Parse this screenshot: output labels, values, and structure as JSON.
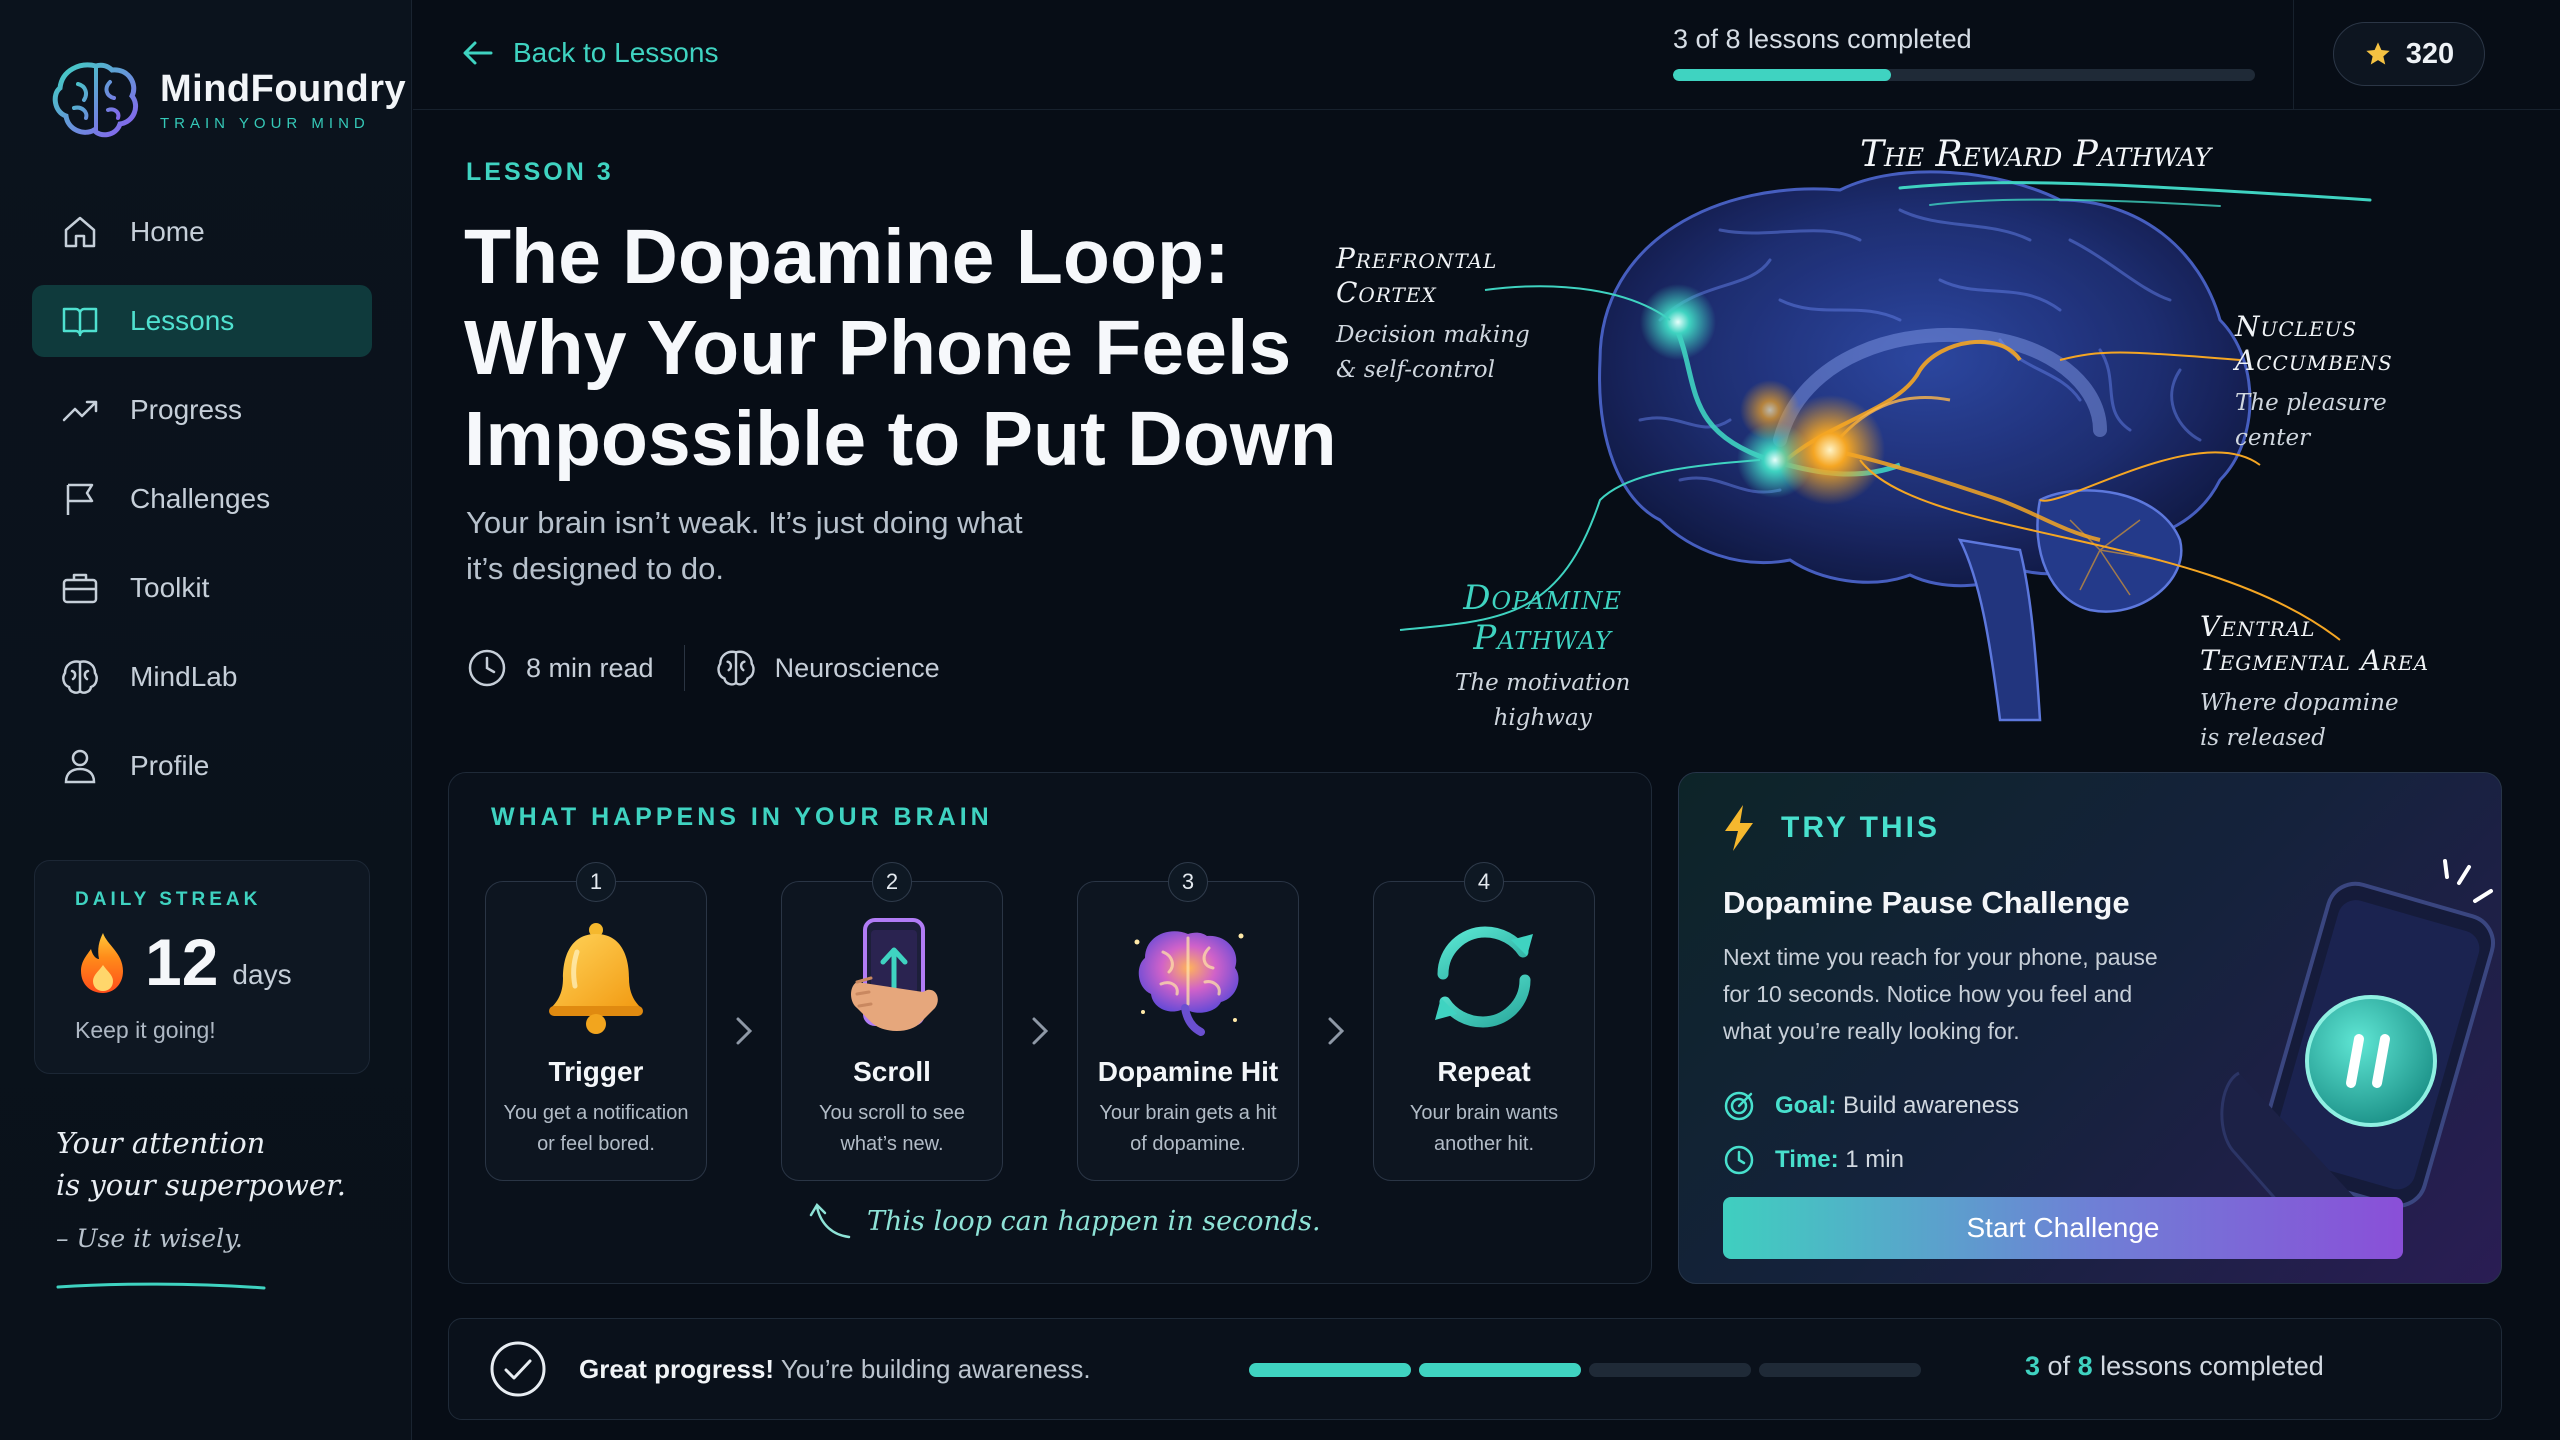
{
  "brand": {
    "name": "MindFoundry",
    "tagline": "TRAIN YOUR MIND",
    "logo_icon": "brain-logo-icon"
  },
  "sidebar": {
    "items": [
      {
        "label": "Home",
        "icon": "home-icon",
        "active": false
      },
      {
        "label": "Lessons",
        "icon": "book-icon",
        "active": true
      },
      {
        "label": "Progress",
        "icon": "trend-icon",
        "active": false
      },
      {
        "label": "Challenges",
        "icon": "flag-icon",
        "active": false
      },
      {
        "label": "Toolkit",
        "icon": "briefcase-icon",
        "active": false
      },
      {
        "label": "MindLab",
        "icon": "brain-icon",
        "active": false
      },
      {
        "label": "Profile",
        "icon": "user-icon",
        "active": false
      }
    ],
    "streak": {
      "label": "DAILY STREAK",
      "count": "12",
      "unit": "days",
      "note": "Keep it going!"
    },
    "quote": {
      "line1": "Your attention",
      "line2": "is your superpower.",
      "attribution": "– Use it wisely."
    }
  },
  "topbar": {
    "back_label": "Back to Lessons",
    "progress_text": "3 of 8 lessons completed",
    "progress_fraction": 0.375,
    "points": "320"
  },
  "lesson": {
    "label": "LESSON 3",
    "title_line1": "The Dopamine Loop:",
    "title_line2": "Why Your Phone Feels",
    "title_line3": "Impossible to Put Down",
    "subtitle_line1": "Your brain isn’t weak. It’s just doing what",
    "subtitle_line2": "it’s designed to do.",
    "read_time": "8 min read",
    "category": "Neuroscience"
  },
  "diagram": {
    "heading": "The Reward Pathway",
    "annotations": {
      "prefrontal": {
        "title1": "Prefrontal",
        "title2": "Cortex",
        "sub1": "Decision making",
        "sub2": "& self-control"
      },
      "nucleus": {
        "title1": "Nucleus",
        "title2": "Accumbens",
        "sub1": "The pleasure",
        "sub2": "center"
      },
      "dopamine": {
        "title1": "Dopamine",
        "title2": "Pathway",
        "sub1": "The motivation",
        "sub2": "highway"
      },
      "vta": {
        "title1": "Ventral",
        "title2": "Tegmental Area",
        "sub1": "Where dopamine",
        "sub2": "is released"
      }
    },
    "colors": {
      "teal": "#3fd3c1",
      "amber": "#f5a623",
      "brain": "#2b3f8f"
    }
  },
  "happens": {
    "title": "WHAT HAPPENS IN YOUR BRAIN",
    "steps": [
      {
        "num": "1",
        "name": "Trigger",
        "desc1": "You get a notification",
        "desc2": "or feel bored.",
        "icon": "bell-icon"
      },
      {
        "num": "2",
        "name": "Scroll",
        "desc1": "You scroll to see",
        "desc2": "what’s new.",
        "icon": "phone-scroll-icon"
      },
      {
        "num": "3",
        "name": "Dopamine Hit",
        "desc1": "Your brain gets a hit",
        "desc2": "of dopamine.",
        "icon": "glowing-brain-icon"
      },
      {
        "num": "4",
        "name": "Repeat",
        "desc1": "Your brain wants",
        "desc2": "another hit.",
        "icon": "repeat-icon"
      }
    ],
    "note": "This loop can happen in seconds."
  },
  "try_this": {
    "heading": "TRY THIS",
    "title": "Dopamine Pause Challenge",
    "desc1": "Next time you reach for your phone, pause",
    "desc2": "for 10 seconds. Notice how you feel and",
    "desc3": "what you’re really looking for.",
    "goal_label": "Goal:",
    "goal_value": "Build awareness",
    "time_label": "Time:",
    "time_value": "1 min",
    "button": "Start Challenge"
  },
  "footer": {
    "bold": "Great progress!",
    "text": "You’re building awareness.",
    "segments_total": 4,
    "segments_done": 2,
    "right_a": "3",
    "right_b": "of",
    "right_c": "8",
    "right_d": "lessons completed"
  }
}
